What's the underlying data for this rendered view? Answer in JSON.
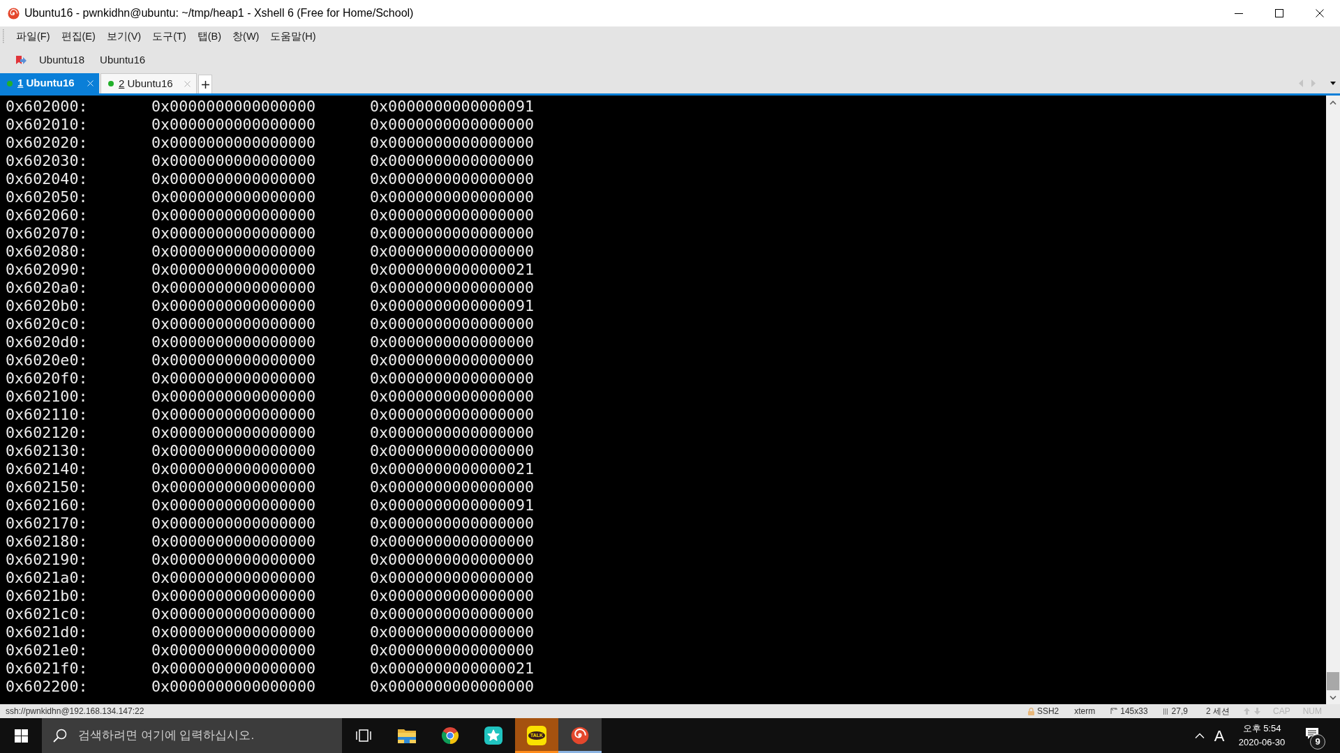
{
  "window": {
    "title": "Ubuntu16 - pwnkidhn@ubuntu: ~/tmp/heap1 - Xshell 6 (Free for Home/School)"
  },
  "menu": [
    "파일(F)",
    "편집(E)",
    "보기(V)",
    "도구(T)",
    "탭(B)",
    "창(W)",
    "도움말(H)"
  ],
  "links_bar": {
    "items": [
      "Ubuntu18",
      "Ubuntu16"
    ]
  },
  "tabs": [
    {
      "number": "1",
      "label": "Ubuntu16",
      "selected": true,
      "connected": true
    },
    {
      "number": "2",
      "label": "Ubuntu16",
      "selected": false,
      "connected": true
    }
  ],
  "terminal": {
    "rows": [
      {
        "address": "0x602000:",
        "values": [
          "0x0000000000000000",
          "0x0000000000000091"
        ]
      },
      {
        "address": "0x602010:",
        "values": [
          "0x0000000000000000",
          "0x0000000000000000"
        ]
      },
      {
        "address": "0x602020:",
        "values": [
          "0x0000000000000000",
          "0x0000000000000000"
        ]
      },
      {
        "address": "0x602030:",
        "values": [
          "0x0000000000000000",
          "0x0000000000000000"
        ]
      },
      {
        "address": "0x602040:",
        "values": [
          "0x0000000000000000",
          "0x0000000000000000"
        ]
      },
      {
        "address": "0x602050:",
        "values": [
          "0x0000000000000000",
          "0x0000000000000000"
        ]
      },
      {
        "address": "0x602060:",
        "values": [
          "0x0000000000000000",
          "0x0000000000000000"
        ]
      },
      {
        "address": "0x602070:",
        "values": [
          "0x0000000000000000",
          "0x0000000000000000"
        ]
      },
      {
        "address": "0x602080:",
        "values": [
          "0x0000000000000000",
          "0x0000000000000000"
        ]
      },
      {
        "address": "0x602090:",
        "values": [
          "0x0000000000000000",
          "0x0000000000000021"
        ]
      },
      {
        "address": "0x6020a0:",
        "values": [
          "0x0000000000000000",
          "0x0000000000000000"
        ]
      },
      {
        "address": "0x6020b0:",
        "values": [
          "0x0000000000000000",
          "0x0000000000000091"
        ]
      },
      {
        "address": "0x6020c0:",
        "values": [
          "0x0000000000000000",
          "0x0000000000000000"
        ]
      },
      {
        "address": "0x6020d0:",
        "values": [
          "0x0000000000000000",
          "0x0000000000000000"
        ]
      },
      {
        "address": "0x6020e0:",
        "values": [
          "0x0000000000000000",
          "0x0000000000000000"
        ]
      },
      {
        "address": "0x6020f0:",
        "values": [
          "0x0000000000000000",
          "0x0000000000000000"
        ]
      },
      {
        "address": "0x602100:",
        "values": [
          "0x0000000000000000",
          "0x0000000000000000"
        ]
      },
      {
        "address": "0x602110:",
        "values": [
          "0x0000000000000000",
          "0x0000000000000000"
        ]
      },
      {
        "address": "0x602120:",
        "values": [
          "0x0000000000000000",
          "0x0000000000000000"
        ]
      },
      {
        "address": "0x602130:",
        "values": [
          "0x0000000000000000",
          "0x0000000000000000"
        ]
      },
      {
        "address": "0x602140:",
        "values": [
          "0x0000000000000000",
          "0x0000000000000021"
        ]
      },
      {
        "address": "0x602150:",
        "values": [
          "0x0000000000000000",
          "0x0000000000000000"
        ]
      },
      {
        "address": "0x602160:",
        "values": [
          "0x0000000000000000",
          "0x0000000000000091"
        ]
      },
      {
        "address": "0x602170:",
        "values": [
          "0x0000000000000000",
          "0x0000000000000000"
        ]
      },
      {
        "address": "0x602180:",
        "values": [
          "0x0000000000000000",
          "0x0000000000000000"
        ]
      },
      {
        "address": "0x602190:",
        "values": [
          "0x0000000000000000",
          "0x0000000000000000"
        ]
      },
      {
        "address": "0x6021a0:",
        "values": [
          "0x0000000000000000",
          "0x0000000000000000"
        ]
      },
      {
        "address": "0x6021b0:",
        "values": [
          "0x0000000000000000",
          "0x0000000000000000"
        ]
      },
      {
        "address": "0x6021c0:",
        "values": [
          "0x0000000000000000",
          "0x0000000000000000"
        ]
      },
      {
        "address": "0x6021d0:",
        "values": [
          "0x0000000000000000",
          "0x0000000000000000"
        ]
      },
      {
        "address": "0x6021e0:",
        "values": [
          "0x0000000000000000",
          "0x0000000000000000"
        ]
      },
      {
        "address": "0x6021f0:",
        "values": [
          "0x0000000000000000",
          "0x0000000000000021"
        ]
      },
      {
        "address": "0x602200:",
        "values": [
          "0x0000000000000000",
          "0x0000000000000000"
        ]
      }
    ]
  },
  "status_bar": {
    "connection": "ssh://pwnkidhn@192.168.134.147:22",
    "protocol": "SSH2",
    "terminal_type": "xterm",
    "size": "145x33",
    "cursor": "27,9",
    "sessions": "2 세션",
    "indicators": [
      {
        "label": "CAP",
        "on": false
      },
      {
        "label": "NUM",
        "on": false
      }
    ]
  },
  "taskbar": {
    "search": {
      "placeholder": "검색하려면 여기에 입력하십시오."
    },
    "apps": [
      {
        "kind": "task-view",
        "active": false,
        "flashing": false
      },
      {
        "kind": "file-explorer",
        "active": false,
        "flashing": false
      },
      {
        "kind": "browser",
        "active": false,
        "flashing": false
      },
      {
        "kind": "star-app",
        "active": false,
        "flashing": false
      },
      {
        "kind": "chat",
        "icon_text": "TALK",
        "active": false,
        "flashing": true
      },
      {
        "kind": "terminal-app",
        "active": true,
        "flashing": false
      }
    ],
    "tray": {
      "ime": "A",
      "time": "오후 5:54",
      "date": "2020-06-30",
      "notifications": "9"
    }
  }
}
